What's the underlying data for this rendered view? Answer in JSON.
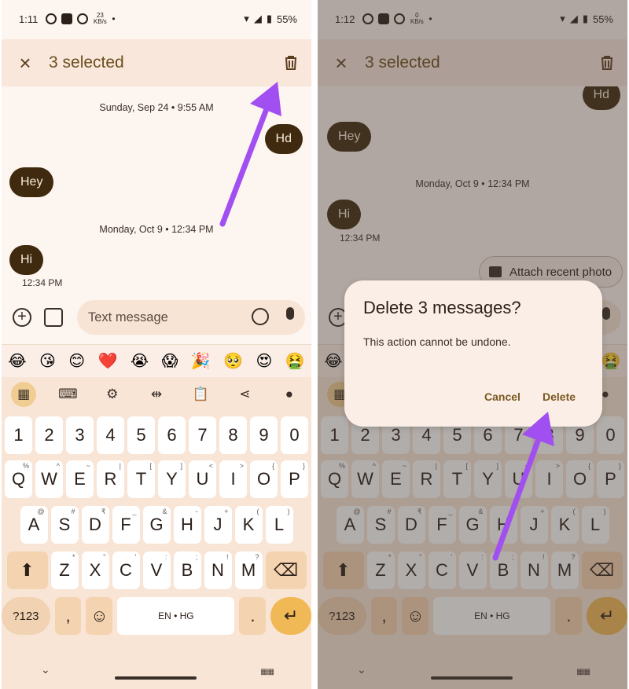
{
  "left": {
    "status": {
      "time": "1:11",
      "speed_top": "23",
      "speed_unit": "KB/s",
      "battery": "55%"
    },
    "appbar": {
      "title": "3 selected"
    },
    "chat": {
      "date1": "Sunday, Sep 24 • 9:55 AM",
      "msg_out": "Hd",
      "msg_in1": "Hey",
      "date2": "Monday, Oct 9 • 12:34 PM",
      "msg_in2": "Hi",
      "time2": "12:34 PM"
    },
    "composer": {
      "placeholder": "Text message"
    }
  },
  "right": {
    "status": {
      "time": "1:12",
      "speed_top": "0",
      "speed_unit": "KB/s",
      "battery": "55%"
    },
    "appbar": {
      "title": "3 selected"
    },
    "chat": {
      "msg_out": "Hd",
      "msg_in1": "Hey",
      "date2": "Monday, Oct 9 • 12:34 PM",
      "msg_in2": "Hi",
      "time2": "12:34 PM",
      "attach": "Attach recent photo"
    },
    "dialog": {
      "title": "Delete 3 messages?",
      "text": "This action cannot be undone.",
      "cancel": "Cancel",
      "delete": "Delete"
    }
  },
  "emojis": [
    "😂",
    "😘",
    "😊",
    "❤️",
    "😭",
    "😱",
    "🎉",
    "🥺",
    "😍",
    "🤮"
  ],
  "toolbar_icons": [
    "grid-icon",
    "keyboard-icon",
    "gear-icon",
    "text-cursor-icon",
    "clipboard-icon",
    "share-icon",
    "mic-icon"
  ],
  "keyboard": {
    "numbers": [
      "1",
      "2",
      "3",
      "4",
      "5",
      "6",
      "7",
      "8",
      "9",
      "0"
    ],
    "row1": [
      "Q",
      "W",
      "E",
      "R",
      "T",
      "Y",
      "U",
      "I",
      "O",
      "P"
    ],
    "row1_hints": [
      "%",
      "^",
      "~",
      "|",
      "[",
      "]",
      "<",
      ">",
      "{",
      "}"
    ],
    "row2": [
      "A",
      "S",
      "D",
      "F",
      "G",
      "H",
      "J",
      "K",
      "L"
    ],
    "row2_hints": [
      "@",
      "#",
      "₹",
      "_",
      "&",
      "-",
      "+",
      "(",
      ")"
    ],
    "row3": [
      "Z",
      "X",
      "C",
      "V",
      "B",
      "N",
      "M"
    ],
    "row3_hints": [
      "*",
      "\"",
      "'",
      ":",
      ";",
      "!",
      "?"
    ],
    "sym": "?123",
    "comma": ",",
    "space": "EN • HG",
    "period": ".",
    "enter": "↵"
  }
}
